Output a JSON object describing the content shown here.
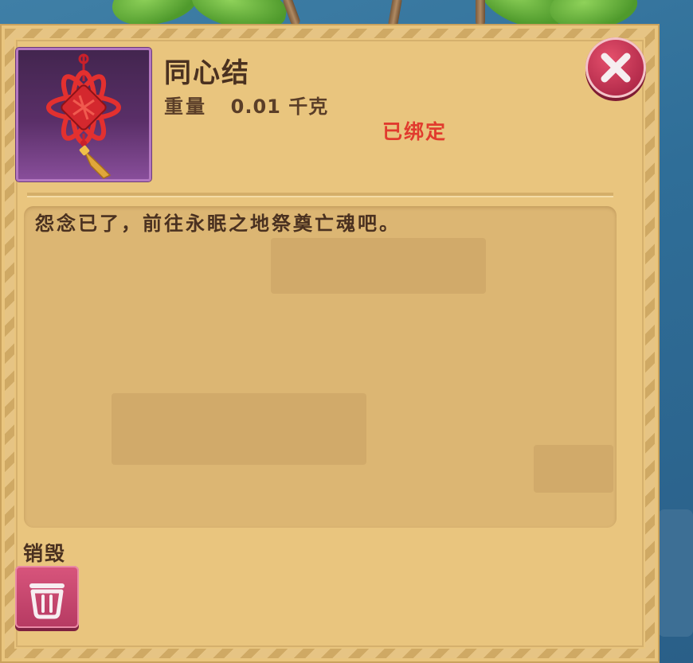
{
  "item": {
    "name": "同心结",
    "weight_label": "重量",
    "weight_value": "0.01 千克",
    "bound_status": "已绑定",
    "description": "怨念已了，前往永眠之地祭奠亡魂吧。",
    "icon": "chinese-knot-icon"
  },
  "actions": {
    "destroy_label": "销毁",
    "destroy_icon": "trash-can-icon",
    "close_icon": "close-icon"
  },
  "colors": {
    "panel": "#e9c57e",
    "bound_status": "#e13b2e",
    "close_button": "#c73457",
    "destroy_button": "#c8466e",
    "icon_frame": "#5a2f68"
  }
}
